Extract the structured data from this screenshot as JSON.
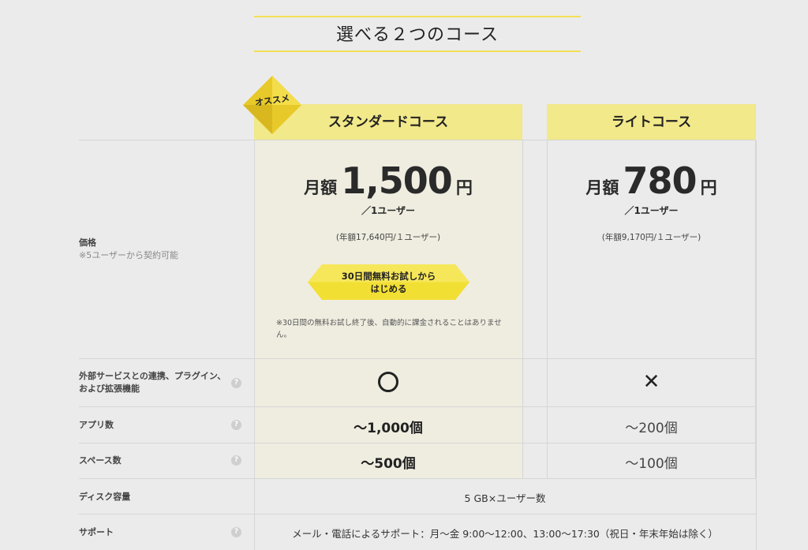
{
  "section_title": "選べる２つのコース",
  "badge": "オススメ",
  "plans": {
    "standard": {
      "name": "スタンダードコース",
      "price_prefix": "月額",
      "price": "1,500",
      "price_suffix": "円",
      "per_user": "／1ユーザー",
      "annual": "(年額17,640円/１ユーザー)",
      "cta": [
        "30日間無料お試しから",
        "はじめる"
      ],
      "note": "※30日間の無料お試し終了後、自動的に課金されることはありません。"
    },
    "lite": {
      "name": "ライトコース",
      "price_prefix": "月額",
      "price": "780",
      "price_suffix": "円",
      "per_user": "／1ユーザー",
      "annual": "(年額9,170円/１ユーザー)"
    }
  },
  "rows": {
    "price": {
      "label": "価格",
      "sub": "※5ユーザーから契約可能"
    },
    "external": {
      "label_line1": "外部サービスとの連携、プラグイン、",
      "label_line2": "および拡張機能",
      "standard": "circle",
      "lite": "cross"
    },
    "apps": {
      "label": "アプリ数",
      "standard": "〜1,000個",
      "lite": "〜200個"
    },
    "spaces": {
      "label": "スペース数",
      "standard": "〜500個",
      "lite": "〜100個"
    },
    "disk": {
      "label": "ディスク容量",
      "value": "5 GB×ユーザー数"
    },
    "support": {
      "label": "サポート",
      "value": "メール・電話によるサポート：月〜金 9:00〜12:00、13:00〜17:30（祝日・年末年始は除く）"
    }
  },
  "help_glyph": "?",
  "colors": {
    "accent_yellow": "#f2df55",
    "header_yellow": "#f2e98a",
    "highlight_bg": "#efede0",
    "background": "#ebebeb"
  }
}
